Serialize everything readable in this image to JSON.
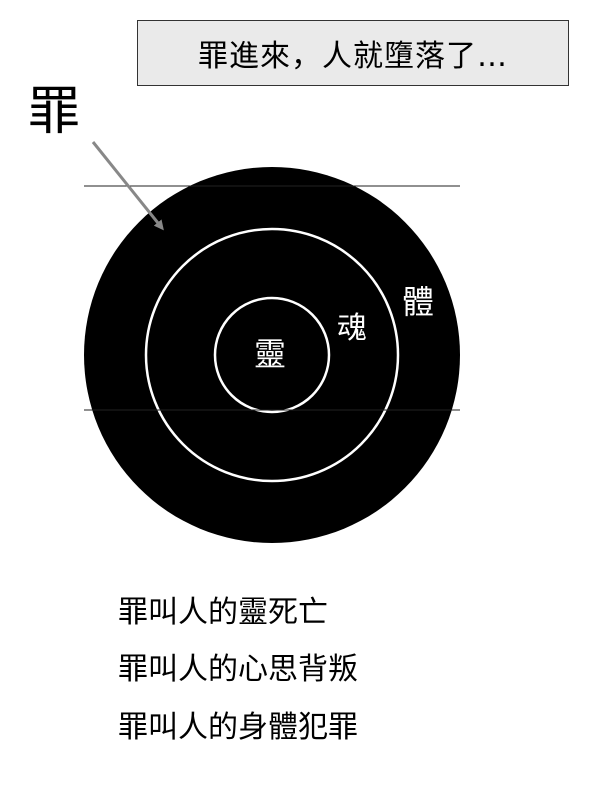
{
  "header": {
    "title": "罪進來，人就墮落了…"
  },
  "diagram": {
    "pointer_label": "罪",
    "layers": [
      {
        "label": "體"
      },
      {
        "label": "魂"
      },
      {
        "label": "靈"
      }
    ],
    "colors": {
      "fill": "#000000",
      "ring": "#ffffff",
      "arrow": "#888888",
      "title_bg": "#eaeaea"
    }
  },
  "captions": [
    "罪叫人的靈死亡",
    "罪叫人的心思背叛",
    "罪叫人的身體犯罪"
  ]
}
